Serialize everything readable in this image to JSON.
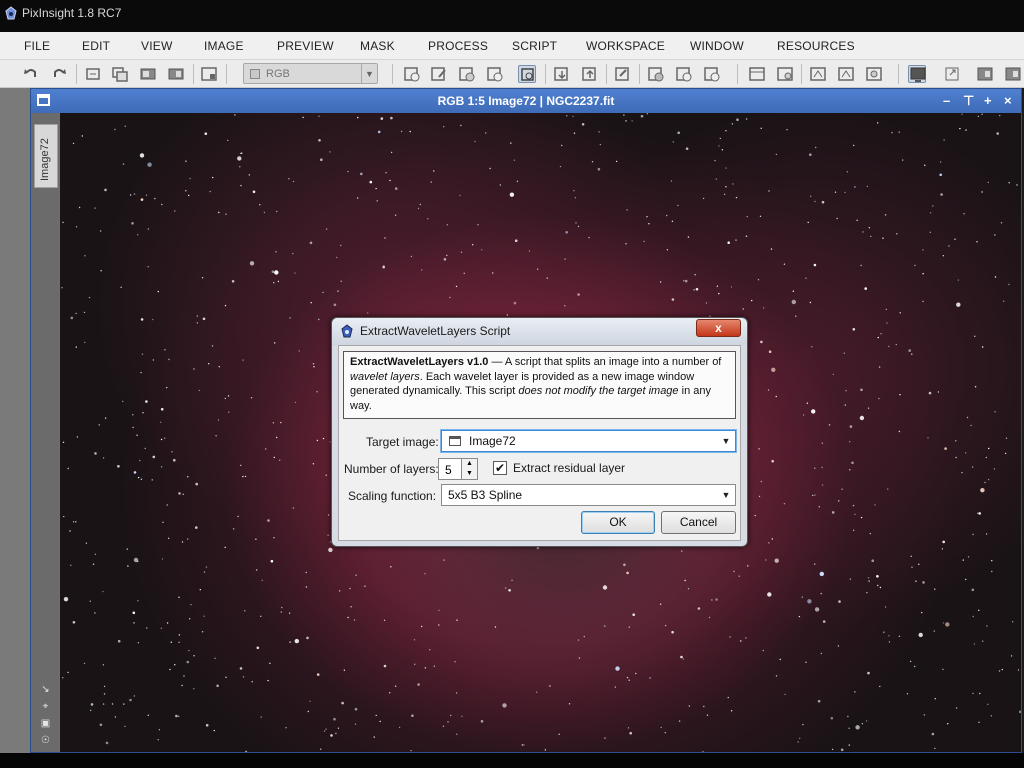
{
  "app": {
    "title": "PixInsight 1.8 RC7"
  },
  "menu": {
    "items": [
      {
        "label": "FILE",
        "id": "file"
      },
      {
        "label": "EDIT",
        "id": "edit"
      },
      {
        "label": "VIEW",
        "id": "view"
      },
      {
        "label": "IMAGE",
        "id": "image"
      },
      {
        "label": "PREVIEW",
        "id": "preview"
      },
      {
        "label": "MASK",
        "id": "mask"
      },
      {
        "label": "PROCESS",
        "id": "process"
      },
      {
        "label": "SCRIPT",
        "id": "script"
      },
      {
        "label": "WORKSPACE",
        "id": "workspace"
      },
      {
        "label": "WINDOW",
        "id": "window"
      },
      {
        "label": "RESOURCES",
        "id": "resources"
      }
    ]
  },
  "toolbar": {
    "view_mode_combo": "RGB"
  },
  "image_window": {
    "title": "RGB 1:5 Image72 | NGC2237.fit",
    "side_tab_label": "Image72",
    "controls": [
      "minimize",
      "shade",
      "maximize",
      "close"
    ]
  },
  "dialog": {
    "title": "ExtractWaveletLayers Script",
    "close_label": "x",
    "info": {
      "name": "ExtractWaveletLayers v1.0",
      "dash": " — ",
      "text1": "A script that splits an image into a number of ",
      "em1": "wavelet layers",
      "text2": ". Each wavelet layer is provided as a new image window generated dynamically. This script ",
      "em2": "does not modify the target image",
      "text3": " in any way."
    },
    "target_image_label": "Target image:",
    "target_image_value": "Image72",
    "num_layers_label": "Number of layers:",
    "num_layers_value": "5",
    "residual_label": "Extract residual layer",
    "residual_checked": true,
    "scaling_label": "Scaling function:",
    "scaling_value": "5x5 B3 Spline",
    "ok_label": "OK",
    "cancel_label": "Cancel"
  },
  "colors": {
    "window_frame": "#4472c4",
    "nebula": "#96284a",
    "close_button": "#c3371a"
  }
}
